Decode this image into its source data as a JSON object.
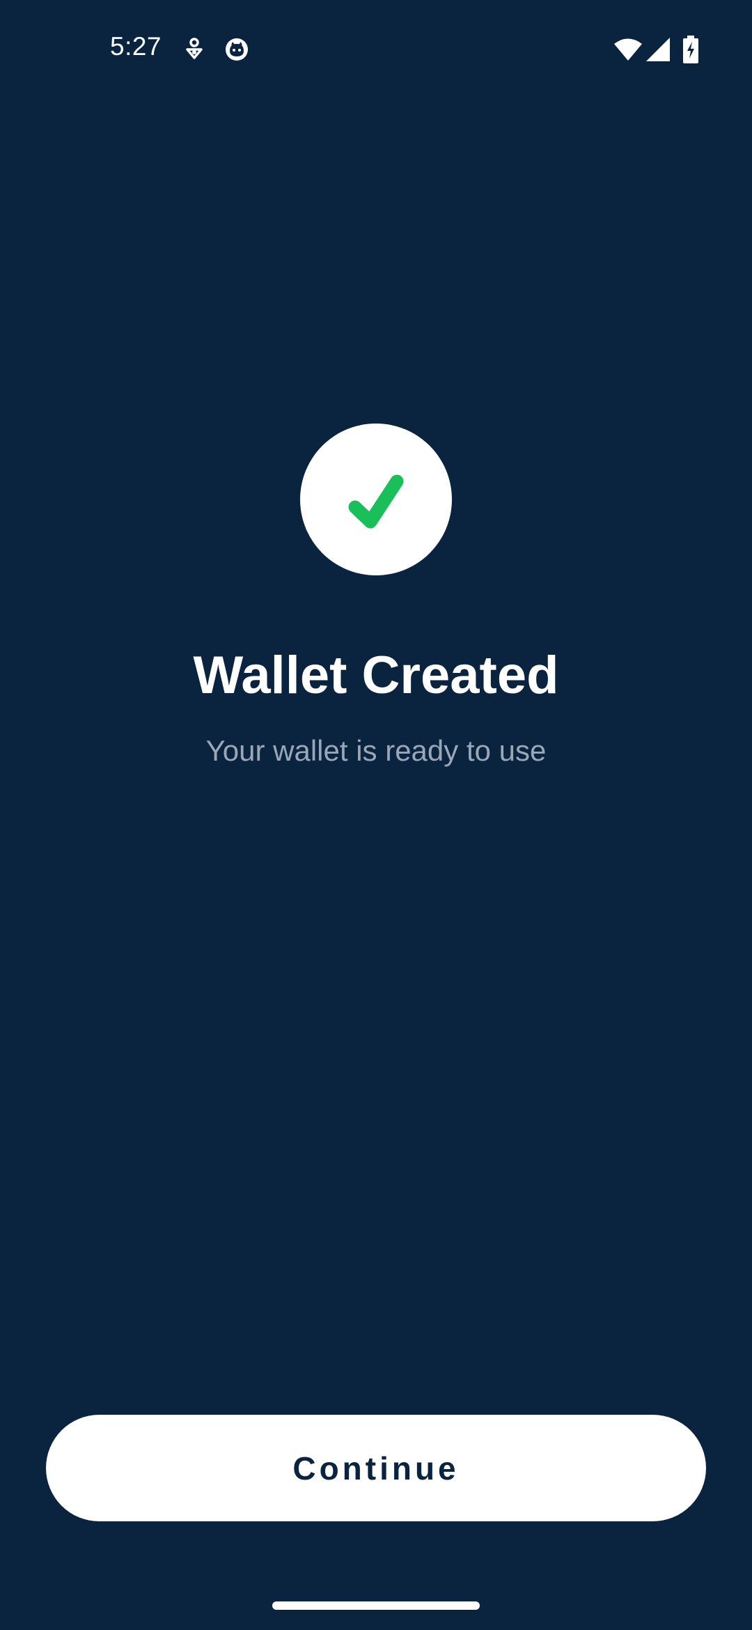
{
  "status_bar": {
    "time": "5:27",
    "icons": [
      "nfc-pay-icon",
      "face-icon",
      "wifi-icon",
      "cell-signal-icon",
      "battery-charging-icon"
    ]
  },
  "success": {
    "icon": "checkmark-icon",
    "title": "Wallet Created",
    "subtitle": "Your wallet is ready to use"
  },
  "actions": {
    "continue_label": "Continue"
  },
  "colors": {
    "background": "#0a2440",
    "check": "#19c05a",
    "subtitle": "#9aa7b7",
    "button_bg": "#ffffff",
    "button_text": "#0a2440"
  }
}
